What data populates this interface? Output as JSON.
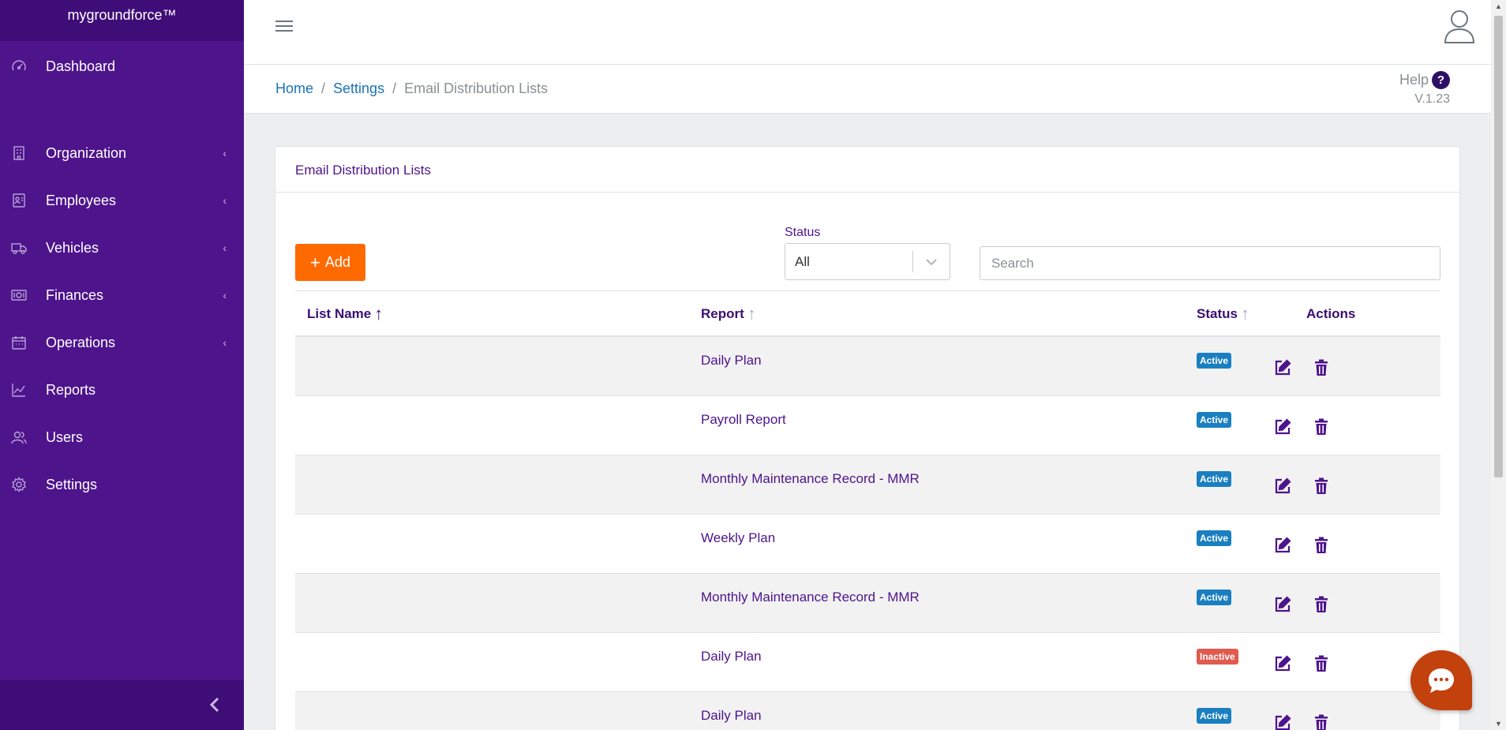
{
  "app": {
    "brand": "mygroundforce™"
  },
  "sidebar": {
    "items": [
      {
        "label": "Dashboard",
        "icon": "dashboard-icon",
        "has_children": false
      },
      {
        "label": "Organization",
        "icon": "building-icon",
        "has_children": true
      },
      {
        "label": "Employees",
        "icon": "id-card-icon",
        "has_children": true
      },
      {
        "label": "Vehicles",
        "icon": "truck-icon",
        "has_children": true
      },
      {
        "label": "Finances",
        "icon": "money-icon",
        "has_children": true
      },
      {
        "label": "Operations",
        "icon": "calendar-icon",
        "has_children": true
      },
      {
        "label": "Reports",
        "icon": "line-chart-icon",
        "has_children": false
      },
      {
        "label": "Users",
        "icon": "users-icon",
        "has_children": false
      },
      {
        "label": "Settings",
        "icon": "gear-icon",
        "has_children": false
      }
    ]
  },
  "breadcrumb": {
    "home": "Home",
    "settings": "Settings",
    "current": "Email Distribution Lists"
  },
  "help": {
    "label": "Help",
    "icon_text": "?",
    "version": "V.1.23"
  },
  "card": {
    "title": "Email Distribution Lists"
  },
  "toolbar": {
    "add_label": "Add",
    "status_label": "Status",
    "status_value": "All",
    "search_placeholder": "Search"
  },
  "table": {
    "headers": {
      "list_name": "List Name",
      "report": "Report",
      "status": "Status",
      "actions": "Actions"
    },
    "rows": [
      {
        "list_name": "",
        "report": "Daily Plan",
        "status": "Active"
      },
      {
        "list_name": "",
        "report": "Payroll Report",
        "status": "Active"
      },
      {
        "list_name": "",
        "report": "Monthly Maintenance Record - MMR",
        "status": "Active"
      },
      {
        "list_name": "",
        "report": "Weekly Plan",
        "status": "Active"
      },
      {
        "list_name": "",
        "report": "Monthly Maintenance Record - MMR",
        "status": "Active"
      },
      {
        "list_name": "",
        "report": "Daily Plan",
        "status": "Inactive"
      },
      {
        "list_name": "",
        "report": "Daily Plan",
        "status": "Active"
      }
    ]
  },
  "colors": {
    "sidebar": "#4e148c",
    "accent": "#ff6a00",
    "active_badge": "#1a7fc1",
    "inactive_badge": "#e05a4f",
    "action_icon": "#4e148c"
  }
}
